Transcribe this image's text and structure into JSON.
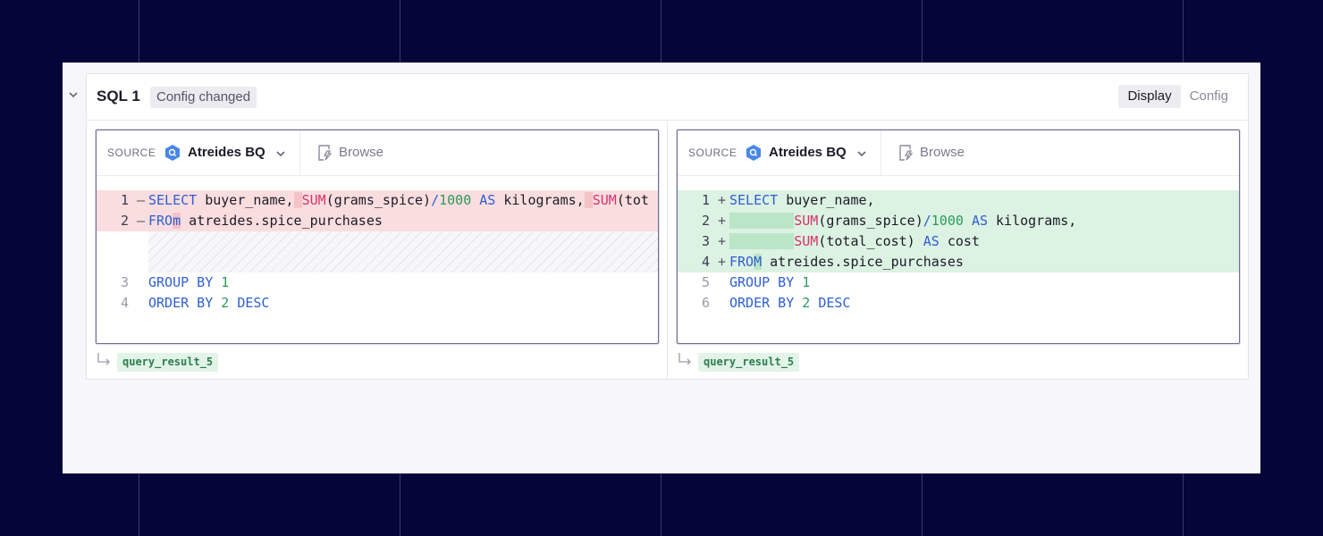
{
  "cell": {
    "title": "SQL 1",
    "status_badge": "Config changed",
    "view_toggle": {
      "display": "Display",
      "config": "Config",
      "active": "Display"
    }
  },
  "left": {
    "source_label": "SOURCE",
    "db_name": "Atreides BQ",
    "browse_label": "Browse",
    "result_name": "query_result_5"
  },
  "right": {
    "source_label": "SOURCE",
    "db_name": "Atreides BQ",
    "browse_label": "Browse",
    "result_name": "query_result_5"
  },
  "colors": {
    "background": "#05053a",
    "deleted_line": "#fadddf",
    "added_line": "#dcf2e2",
    "keyword": "#2f5fd0",
    "function": "#d6336c",
    "number": "#2e9a5a"
  },
  "icons": {
    "collapse": "chevron-down-icon",
    "database": "bigquery-icon",
    "dropdown": "chevron-down-icon",
    "browse": "browse-schema-icon",
    "result": "return-arrow-icon"
  }
}
